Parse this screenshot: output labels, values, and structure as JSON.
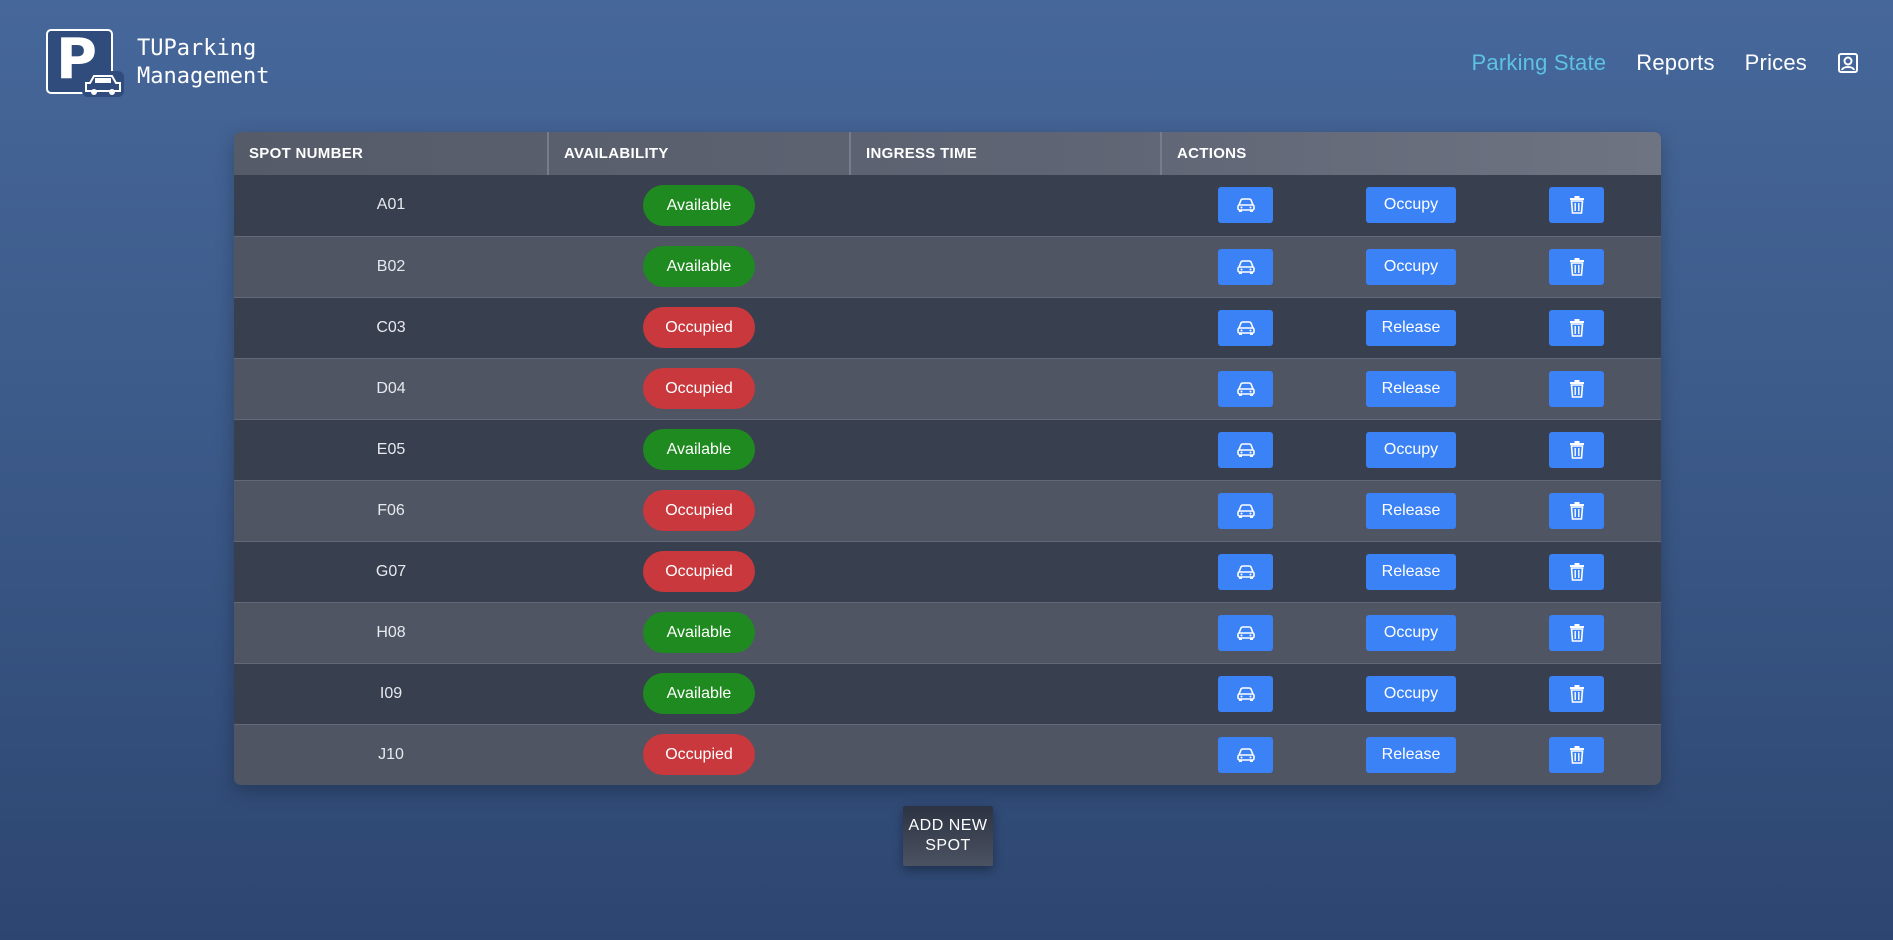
{
  "app": {
    "title_line1": "TUParking",
    "title_line2": "Management"
  },
  "nav": {
    "items": [
      {
        "label": "Parking State",
        "active": true
      },
      {
        "label": "Reports",
        "active": false
      },
      {
        "label": "Prices",
        "active": false
      }
    ],
    "profile_icon": "user-square-icon"
  },
  "table": {
    "headers": [
      "SPOT NUMBER",
      "AVAILABILITY",
      "INGRESS TIME",
      "ACTIONS"
    ],
    "rows": [
      {
        "spot": "A01",
        "availability": "Available",
        "status": "available",
        "ingress_time": "",
        "action": "Occupy"
      },
      {
        "spot": "B02",
        "availability": "Available",
        "status": "available",
        "ingress_time": "",
        "action": "Occupy"
      },
      {
        "spot": "C03",
        "availability": "Occupied",
        "status": "occupied",
        "ingress_time": "",
        "action": "Release"
      },
      {
        "spot": "D04",
        "availability": "Occupied",
        "status": "occupied",
        "ingress_time": "",
        "action": "Release"
      },
      {
        "spot": "E05",
        "availability": "Available",
        "status": "available",
        "ingress_time": "",
        "action": "Occupy"
      },
      {
        "spot": "F06",
        "availability": "Occupied",
        "status": "occupied",
        "ingress_time": "",
        "action": "Release"
      },
      {
        "spot": "G07",
        "availability": "Occupied",
        "status": "occupied",
        "ingress_time": "",
        "action": "Release"
      },
      {
        "spot": "H08",
        "availability": "Available",
        "status": "available",
        "ingress_time": "",
        "action": "Occupy"
      },
      {
        "spot": "I09",
        "availability": "Available",
        "status": "available",
        "ingress_time": "",
        "action": "Occupy"
      },
      {
        "spot": "J10",
        "availability": "Occupied",
        "status": "occupied",
        "ingress_time": "",
        "action": "Release"
      }
    ],
    "row_icons": {
      "vehicle": "car-icon",
      "delete": "trash-icon"
    }
  },
  "add_button": {
    "line1": "ADD NEW",
    "line2": "SPOT"
  },
  "colors": {
    "accent": "#3b82f6",
    "nav_active": "#5ec2e3",
    "available": "#1f8a1f",
    "occupied": "#c8383d"
  }
}
